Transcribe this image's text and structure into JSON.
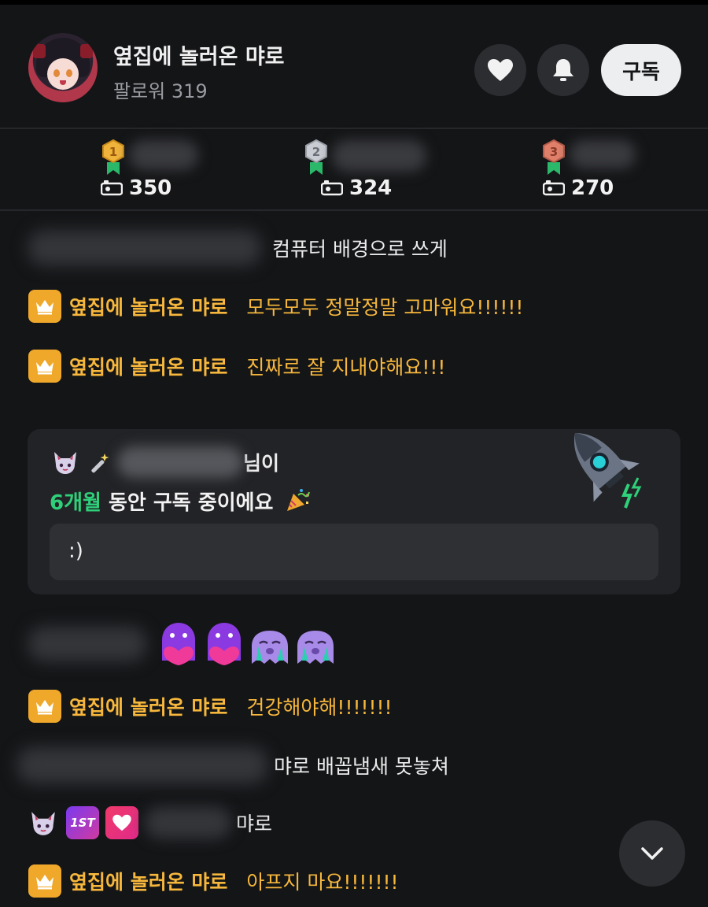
{
  "header": {
    "channel_name": "옆집에 놀러온 먀로",
    "followers": "팔로워 319",
    "subscribe_label": "구독"
  },
  "ranking": [
    {
      "place": "1",
      "score": "350",
      "medal_color": "#f0b43a"
    },
    {
      "place": "2",
      "score": "324",
      "medal_color": "#c9ccd2"
    },
    {
      "place": "3",
      "score": "270",
      "medal_color": "#e0806a"
    }
  ],
  "chat": {
    "messages": [
      {
        "type": "user",
        "text": "컴퓨터 배경으로 쓰게"
      },
      {
        "type": "owner",
        "name": "옆집에 놀러온 먀로",
        "text": "모두모두 정말정말 고마워요!!!!!!"
      },
      {
        "type": "owner",
        "name": "옆집에 놀러온 먀로",
        "text": "진짜로 잘 지내야해요!!!"
      },
      {
        "type": "subscription",
        "name_suffix": "님이",
        "months": "6개월",
        "line_rest": " 동안 구독 중이에요",
        "message": ":)"
      },
      {
        "type": "user-emotes",
        "text": ""
      },
      {
        "type": "owner",
        "name": "옆집에 놀러온 먀로",
        "text": "건강해야해!!!!!!!"
      },
      {
        "type": "user",
        "text": "먀로 배꼽냄새 못놓쳐"
      },
      {
        "type": "user-badges",
        "badge_1": "1ST",
        "text": "먀로"
      },
      {
        "type": "owner",
        "name": "옆집에 놀러온 먀로",
        "text": "아프지 마요!!!!!!!"
      }
    ]
  },
  "colors": {
    "owner_accent": "#f6b73c",
    "subscribe_green": "#2ed17a",
    "background": "#141517"
  }
}
